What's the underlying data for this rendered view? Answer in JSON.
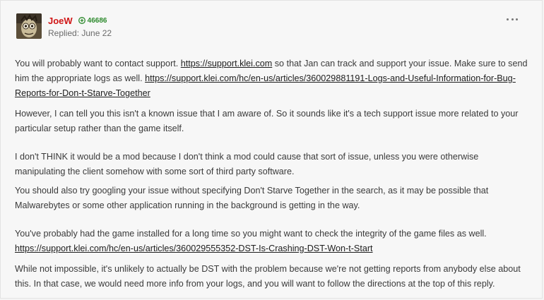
{
  "post": {
    "author": "JoeW",
    "reputation": "46686",
    "replied": "Replied: June 22",
    "more_icon": "ellipsis-icon",
    "accent_color": "#d01616",
    "rep_color": "#2d8a2d",
    "paragraphs": [
      {
        "t1": "You will probably want to contact support. ",
        "link1": "https://support.klei.com",
        "t2": " so that Jan can track and support your issue. Make sure to send him the appropriate logs as well. ",
        "link2": "https://support.klei.com/hc/en-us/articles/360029881191-Logs-and-Useful-Information-for-Bug-Reports-for-Don-t-Starve-Together"
      },
      {
        "text": "However, I can tell you this isn't a known issue that I am aware of. So it sounds like it's a tech support issue more related to your particular setup rather than the game itself."
      },
      {
        "text": "I don't THINK it would be a mod because I don't think a mod could cause that sort of issue, unless you were otherwise manipulating the client somehow with some sort of third party software."
      },
      {
        "text": "You should also try googling your issue without specifying Don't Starve Together in the search, as it may be possible that Malwarebytes or some other application running in the background is getting in the way."
      },
      {
        "t1": "You've probably had the game installed for a long time so you might want to check the integrity of the game files as well. ",
        "link1": "https://support.klei.com/hc/en-us/articles/360029555352-DST-Is-Crashing-DST-Won-t-Start"
      },
      {
        "text": "While not impossible, it's unlikely to actually be DST with the problem because we're not getting reports from anybody else about this. In that case, we would need more info from your logs, and you will want to follow the directions at the top of this reply."
      }
    ]
  }
}
